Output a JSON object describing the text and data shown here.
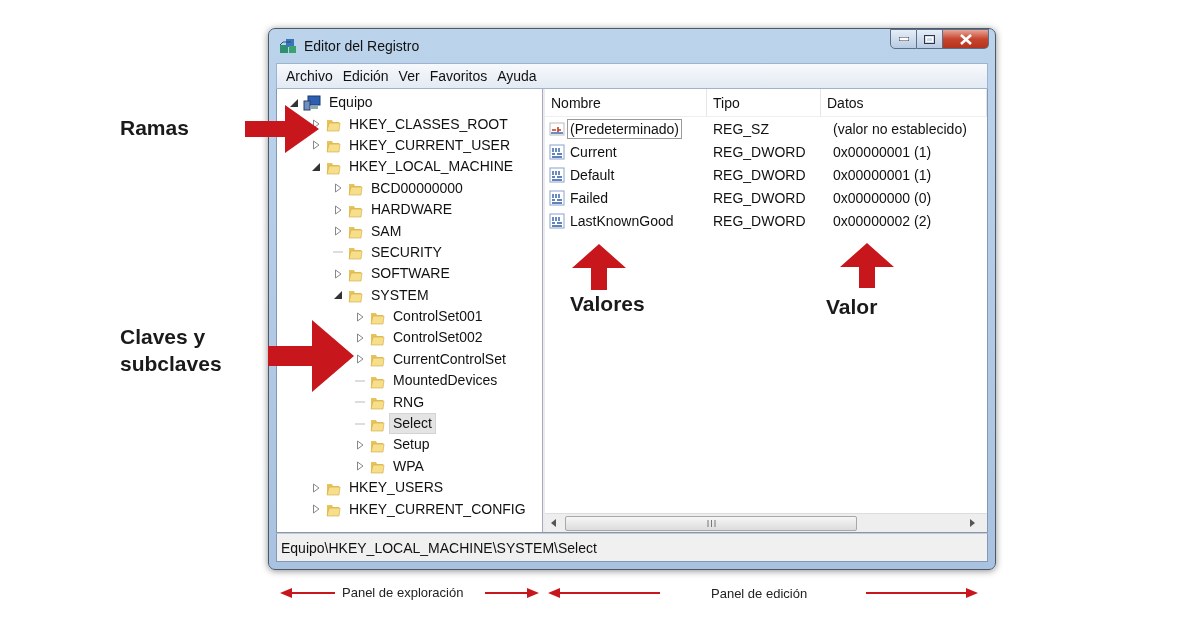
{
  "window": {
    "title": "Editor del Registro"
  },
  "menu": [
    "Archivo",
    "Edición",
    "Ver",
    "Favoritos",
    "Ayuda"
  ],
  "tree": {
    "label": "Equipo",
    "kind": "computer",
    "expandable": true,
    "expanded": true,
    "selected": false,
    "children": [
      {
        "label": "HKEY_CLASSES_ROOT",
        "kind": "folder",
        "expandable": true,
        "expanded": false,
        "selected": false
      },
      {
        "label": "HKEY_CURRENT_USER",
        "kind": "folder",
        "expandable": true,
        "expanded": false,
        "selected": false
      },
      {
        "label": "HKEY_LOCAL_MACHINE",
        "kind": "folder",
        "expandable": true,
        "expanded": true,
        "selected": false,
        "children": [
          {
            "label": "BCD00000000",
            "kind": "folder",
            "expandable": true,
            "expanded": false,
            "selected": false
          },
          {
            "label": "HARDWARE",
            "kind": "folder",
            "expandable": true,
            "expanded": false,
            "selected": false
          },
          {
            "label": "SAM",
            "kind": "folder",
            "expandable": true,
            "expanded": false,
            "selected": false
          },
          {
            "label": "SECURITY",
            "kind": "folder",
            "expandable": false,
            "expanded": false,
            "selected": false
          },
          {
            "label": "SOFTWARE",
            "kind": "folder",
            "expandable": true,
            "expanded": false,
            "selected": false
          },
          {
            "label": "SYSTEM",
            "kind": "folder",
            "expandable": true,
            "expanded": true,
            "selected": false,
            "children": [
              {
                "label": "ControlSet001",
                "kind": "folder",
                "expandable": true,
                "expanded": false,
                "selected": false
              },
              {
                "label": "ControlSet002",
                "kind": "folder",
                "expandable": true,
                "expanded": false,
                "selected": false
              },
              {
                "label": "CurrentControlSet",
                "kind": "folder",
                "expandable": true,
                "expanded": false,
                "selected": false
              },
              {
                "label": "MountedDevices",
                "kind": "folder",
                "expandable": false,
                "expanded": false,
                "selected": false
              },
              {
                "label": "RNG",
                "kind": "folder",
                "expandable": false,
                "expanded": false,
                "selected": false
              },
              {
                "label": "Select",
                "kind": "folder",
                "expandable": false,
                "expanded": false,
                "selected": true
              },
              {
                "label": "Setup",
                "kind": "folder",
                "expandable": true,
                "expanded": false,
                "selected": false
              },
              {
                "label": "WPA",
                "kind": "folder",
                "expandable": true,
                "expanded": false,
                "selected": false
              }
            ]
          }
        ]
      },
      {
        "label": "HKEY_USERS",
        "kind": "folder",
        "expandable": true,
        "expanded": false,
        "selected": false
      },
      {
        "label": "HKEY_CURRENT_CONFIG",
        "kind": "folder",
        "expandable": true,
        "expanded": false,
        "selected": false
      }
    ]
  },
  "values": {
    "columns": [
      "Nombre",
      "Tipo",
      "Datos"
    ],
    "rows": [
      {
        "name": "(Predeterminado)",
        "type": "REG_SZ",
        "data": "(valor no establecido)",
        "kind": "string",
        "focused": true
      },
      {
        "name": "Current",
        "type": "REG_DWORD",
        "data": "0x00000001 (1)",
        "kind": "number",
        "focused": false
      },
      {
        "name": "Default",
        "type": "REG_DWORD",
        "data": "0x00000001 (1)",
        "kind": "number",
        "focused": false
      },
      {
        "name": "Failed",
        "type": "REG_DWORD",
        "data": "0x00000000 (0)",
        "kind": "number",
        "focused": false
      },
      {
        "name": "LastKnownGood",
        "type": "REG_DWORD",
        "data": "0x00000002 (2)",
        "kind": "number",
        "focused": false
      }
    ]
  },
  "status_bar": "Equipo\\HKEY_LOCAL_MACHINE\\SYSTEM\\Select",
  "annotations": [
    {
      "text": "Ramas"
    },
    {
      "text": "Claves y subclaves"
    },
    {
      "text": "Valores"
    },
    {
      "text": "Valor"
    },
    {
      "text": "Panel de exploración"
    },
    {
      "text": "Panel de edición"
    }
  ]
}
